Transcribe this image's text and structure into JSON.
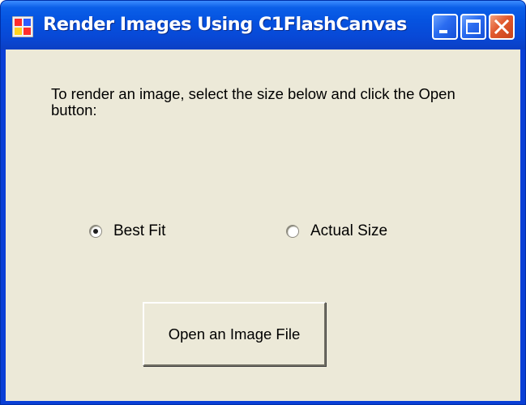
{
  "window": {
    "title": "Render Images Using C1FlashCanvas"
  },
  "titlebar_buttons": [
    "minimize-icon",
    "maximize-icon",
    "close-icon"
  ],
  "form": {
    "instructions": "To render an image, select the size below and click the Open button:",
    "size_options": [
      {
        "label": "Best Fit",
        "selected": true
      },
      {
        "label": "Actual Size",
        "selected": false
      }
    ],
    "open_button_label": "Open an Image File"
  },
  "colors": {
    "titlebar": "#0553e0",
    "client_background": "#ece9d8",
    "close_button": "#e1582d"
  }
}
